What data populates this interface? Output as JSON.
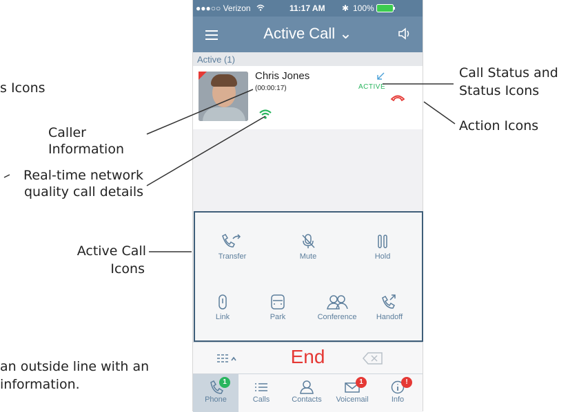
{
  "callouts": {
    "top_left": "s Icons",
    "caller_info": "Caller Information",
    "network_1": "Real-time network",
    "network_2": "quality call details",
    "active_icons_1": "Active Call",
    "active_icons_2": "Icons",
    "bottom_1": "an outside line with an",
    "bottom_2": "information.",
    "status_1": "Call Status and",
    "status_2": "Status Icons",
    "action_icons": "Action Icons"
  },
  "statusbar": {
    "carrier": "●●●○○ Verizon",
    "time": "11:17 AM",
    "battery": "100%"
  },
  "navbar": {
    "title": "Active Call ⌄"
  },
  "section": {
    "label": "Active (1)"
  },
  "call": {
    "name": "Chris Jones",
    "duration": "(00:00:17)",
    "status": "ACTIVE"
  },
  "actions": [
    {
      "label": "Transfer",
      "icon": "transfer-icon"
    },
    {
      "label": "Mute",
      "icon": "mute-icon"
    },
    {
      "label": "Hold",
      "icon": "hold-icon"
    },
    {
      "label": "Link",
      "icon": "link-icon"
    },
    {
      "label": "Park",
      "icon": "park-icon"
    },
    {
      "label": "Conference",
      "icon": "conference-icon"
    },
    {
      "label": "Handoff",
      "icon": "handoff-icon"
    }
  ],
  "bottom": {
    "end_label": "End"
  },
  "tabs": [
    {
      "label": "Phone",
      "badge": "1"
    },
    {
      "label": "Calls",
      "badge": ""
    },
    {
      "label": "Contacts",
      "badge": ""
    },
    {
      "label": "Voicemail",
      "badge": "1"
    },
    {
      "label": "Info",
      "badge": "!"
    }
  ],
  "colors": {
    "accent": "#6b8ba8",
    "active_green": "#29b55e",
    "end_red": "#e53935",
    "badge_green": "#29b55e",
    "badge_red": "#e53935"
  }
}
